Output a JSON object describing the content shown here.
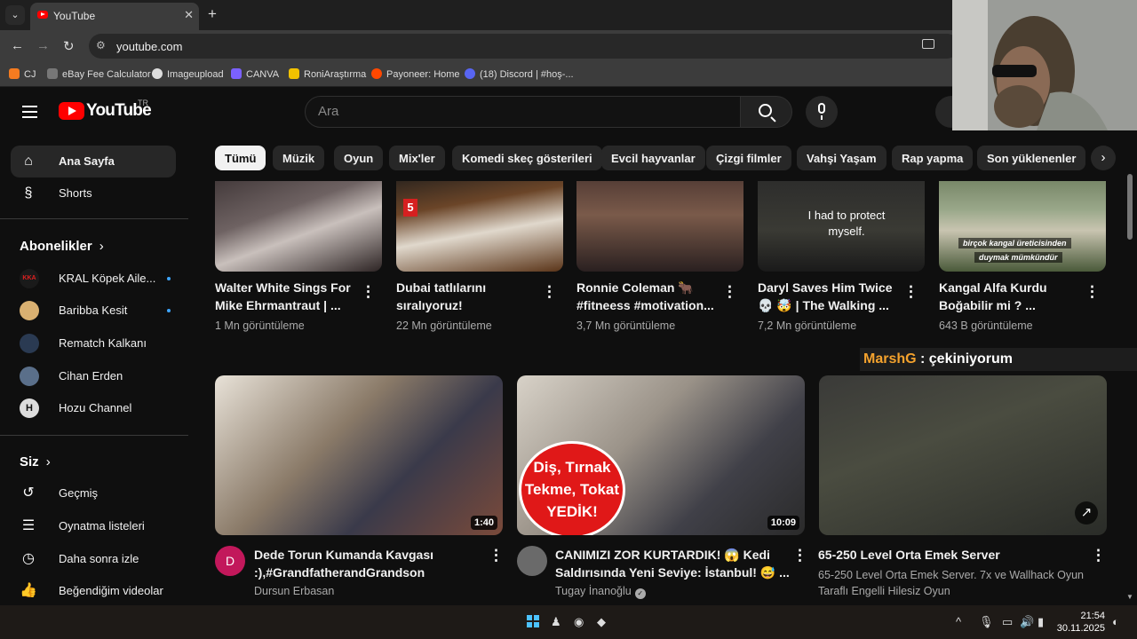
{
  "browser": {
    "tab_title": "YouTube",
    "url": "youtube.com",
    "bookmarks": [
      "CJ",
      "eBay Fee Calculator",
      "Imageupload",
      "CANVA",
      "RoniAraştırma",
      "Payoneer: Home",
      "(18) Discord | #hoş-..."
    ]
  },
  "header": {
    "logo_text": "YouTube",
    "logo_region": "TR",
    "search_placeholder": "Ara"
  },
  "sidebar": {
    "primary": [
      {
        "label": "Ana Sayfa",
        "icon": "home-icon",
        "active": true
      },
      {
        "label": "Shorts",
        "icon": "shorts-icon"
      }
    ],
    "subscriptions_title": "Abonelikler",
    "subscriptions": [
      {
        "label": "KRAL Köpek Aile...",
        "avatar_text": "KKA",
        "new": true
      },
      {
        "label": "Baribba Kesit",
        "new": true
      },
      {
        "label": "Rematch Kalkanı"
      },
      {
        "label": "Cihan Erden"
      },
      {
        "label": "Hozu Channel"
      }
    ],
    "you_title": "Siz",
    "you": [
      {
        "label": "Geçmiş",
        "icon": "history-icon"
      },
      {
        "label": "Oynatma listeleri",
        "icon": "playlists-icon"
      },
      {
        "label": "Daha sonra izle",
        "icon": "watch-later-icon"
      },
      {
        "label": "Beğendiğim videolar",
        "icon": "liked-videos-icon"
      }
    ]
  },
  "chips": [
    "Tümü",
    "Müzik",
    "Oyun",
    "Mix'ler",
    "Komedi skeç gösterileri",
    "Evcil hayvanlar",
    "Çizgi filmler",
    "Vahşi Yaşam",
    "Rap yapma",
    "Son yüklenenler"
  ],
  "top_row": [
    {
      "title1": "Walter White Sings For",
      "title2": "Mike Ehrmantraut | ...",
      "views": "1 Mn görüntüleme"
    },
    {
      "title1": "Dubai tatlılarını",
      "title2": "sıralıyoruz!",
      "views": "22 Mn görüntüleme",
      "thumb_badge": "5"
    },
    {
      "title1": "Ronnie Coleman 🐂",
      "title2": "#fitneess #motivation...",
      "views": "3,7 Mn görüntüleme"
    },
    {
      "title1": "Daryl Saves Him Twice",
      "title2": "💀 🤯 | The Walking ...",
      "views": "7,2 Mn görüntüleme",
      "thumb_caption": "I had to protect myself."
    },
    {
      "title1": "Kangal Alfa Kurdu",
      "title2": "Boğabilir mi ? ...",
      "views": "643 B görüntüleme",
      "thumb_caption1": "birçok kangal üreticisinden",
      "thumb_caption2": "duymak mümkündür"
    }
  ],
  "bottom_row": [
    {
      "title1": "Dede Torun Kumanda Kavgası",
      "title2": ":),#GrandfatherandGrandson",
      "channel": "Dursun Erbasan",
      "duration": "1:40",
      "avatar_text": "D"
    },
    {
      "title1": "CANIMIZI ZOR KURTARDIK! 😱 Kedi",
      "title2": "Saldırısında Yeni Seviye: İstanbul! 😅 ...",
      "channel": "Tugay İnanoğlu",
      "duration": "10:09",
      "thumb_overlay": [
        "Diş, Tırnak",
        "Tekme, Tokat",
        "YEDİK!"
      ]
    },
    {
      "title1": "65-250 Level Orta Emek Server",
      "desc1": "65-250 Level Orta Emek Server. 7x ve Wallhack Oyun",
      "desc2": "Taraflı Engelli Hilesiz Oyun"
    }
  ],
  "chat_overlay": {
    "user": "MarshG",
    "message": ": çekiniyorum"
  },
  "taskbar": {
    "time": "21:54",
    "date": "30.11.2025"
  },
  "colors": {
    "brand_red": "#ff0000",
    "background": "#0f0f0f",
    "chip_active": "#f1f1f1",
    "chat_user": "#f4a22d"
  }
}
